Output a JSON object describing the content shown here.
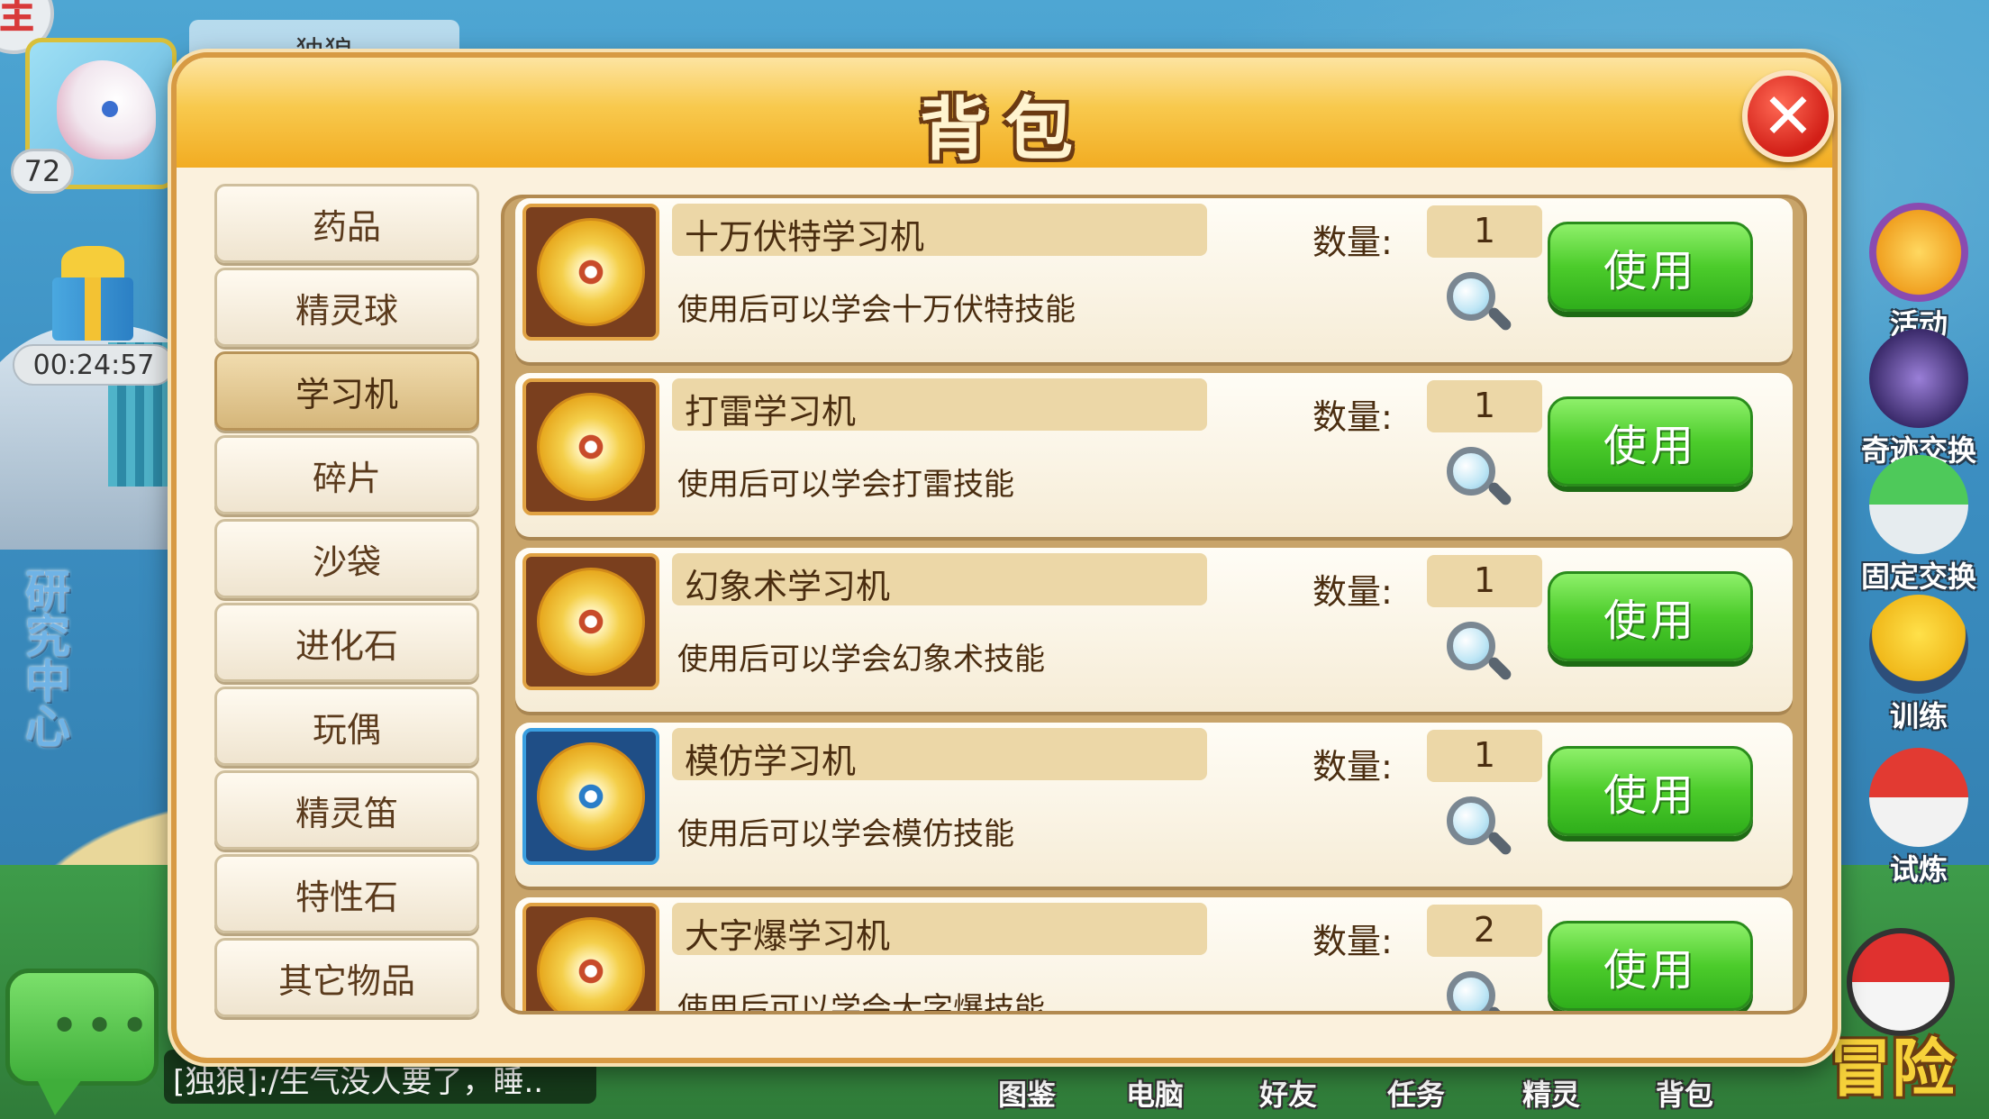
{
  "hud": {
    "player_name": "独狼",
    "level": "72",
    "corner_badge": "佳",
    "gift_timer": "00:24:57",
    "location": "研究中心",
    "chat_line": "[独狼]:/生气没人要了，睡.."
  },
  "side_menu": [
    {
      "label": "活动",
      "icon": "star-icon"
    },
    {
      "label": "奇迹交换",
      "icon": "crystal-ball-icon"
    },
    {
      "label": "固定交换",
      "icon": "pokeball-icon"
    },
    {
      "label": "训练",
      "icon": "pikachu-icon"
    },
    {
      "label": "试炼",
      "icon": "sword-icon"
    }
  ],
  "adventure_label": "冒险",
  "bottom_nav": [
    {
      "label": "图鉴"
    },
    {
      "label": "电脑"
    },
    {
      "label": "好友"
    },
    {
      "label": "任务"
    },
    {
      "label": "精灵"
    },
    {
      "label": "背包"
    }
  ],
  "modal": {
    "title": "背包",
    "close_icon": "close-icon"
  },
  "tabs": [
    {
      "label": "药品",
      "active": false
    },
    {
      "label": "精灵球",
      "active": false
    },
    {
      "label": "学习机",
      "active": true
    },
    {
      "label": "碎片",
      "active": false
    },
    {
      "label": "沙袋",
      "active": false
    },
    {
      "label": "进化石",
      "active": false
    },
    {
      "label": "玩偶",
      "active": false
    },
    {
      "label": "精灵笛",
      "active": false
    },
    {
      "label": "特性石",
      "active": false
    },
    {
      "label": "其它物品",
      "active": false
    }
  ],
  "qty_label": "数量:",
  "use_label": "使用",
  "items": [
    {
      "name": "十万伏特学习机",
      "desc": "使用后可以学会十万伏特技能",
      "qty": "1",
      "icon": "disc-icon",
      "frame": "brown"
    },
    {
      "name": "打雷学习机",
      "desc": "使用后可以学会打雷技能",
      "qty": "1",
      "icon": "disc-icon",
      "frame": "brown"
    },
    {
      "name": "幻象术学习机",
      "desc": "使用后可以学会幻象术技能",
      "qty": "1",
      "icon": "disc-icon",
      "frame": "brown"
    },
    {
      "name": "模仿学习机",
      "desc": "使用后可以学会模仿技能",
      "qty": "1",
      "icon": "disc-icon",
      "frame": "blue"
    },
    {
      "name": "大字爆学习机",
      "desc": "使用后可以学会大字爆技能",
      "qty": "2",
      "icon": "disc-icon",
      "frame": "brown"
    }
  ],
  "colors": {
    "header_gold": "#f2ac22",
    "frame_brown": "#d79a43",
    "use_green": "#4ccc2b",
    "close_red": "#d21f17"
  }
}
